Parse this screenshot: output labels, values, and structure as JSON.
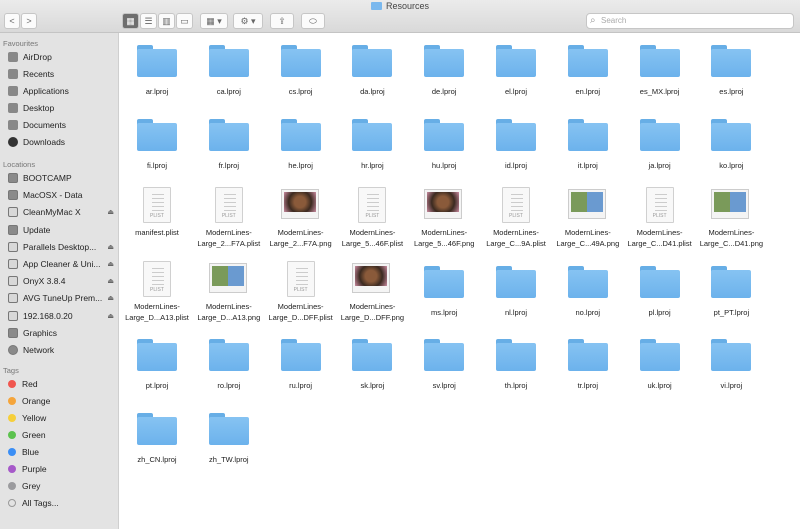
{
  "window": {
    "title": "Resources"
  },
  "toolbar": {
    "back": "<",
    "forward": ">",
    "search_placeholder": "Search"
  },
  "sidebar": {
    "favourites_header": "Favourites",
    "favourites": [
      "AirDrop",
      "Recents",
      "Applications",
      "Desktop",
      "Documents",
      "Downloads"
    ],
    "locations_header": "Locations",
    "locations": [
      {
        "label": "BOOTCAMP",
        "eject": false
      },
      {
        "label": "MacOSX - Data",
        "eject": false
      },
      {
        "label": "CleanMyMac X",
        "eject": true
      },
      {
        "label": "Update",
        "eject": false
      },
      {
        "label": "Parallels Desktop...",
        "eject": true
      },
      {
        "label": "App Cleaner & Uni...",
        "eject": true
      },
      {
        "label": "OnyX 3.8.4",
        "eject": true
      },
      {
        "label": "AVG TuneUp Prem...",
        "eject": true
      },
      {
        "label": "192.168.0.20",
        "eject": true
      },
      {
        "label": "Graphics",
        "eject": false
      },
      {
        "label": "Network",
        "eject": false
      }
    ],
    "tags_header": "Tags",
    "tags": [
      {
        "label": "Red",
        "color": "#f0564f"
      },
      {
        "label": "Orange",
        "color": "#f5a53b"
      },
      {
        "label": "Yellow",
        "color": "#f6cf3a"
      },
      {
        "label": "Green",
        "color": "#5cc24e"
      },
      {
        "label": "Blue",
        "color": "#3a8ef5"
      },
      {
        "label": "Purple",
        "color": "#a659c9"
      },
      {
        "label": "Grey",
        "color": "#9b9b9e"
      },
      {
        "label": "All Tags...",
        "color": ""
      }
    ]
  },
  "files": [
    {
      "name": "ar.lproj",
      "type": "folder"
    },
    {
      "name": "ca.lproj",
      "type": "folder"
    },
    {
      "name": "cs.lproj",
      "type": "folder"
    },
    {
      "name": "da.lproj",
      "type": "folder"
    },
    {
      "name": "de.lproj",
      "type": "folder"
    },
    {
      "name": "el.lproj",
      "type": "folder"
    },
    {
      "name": "en.lproj",
      "type": "folder"
    },
    {
      "name": "es_MX.lproj",
      "type": "folder"
    },
    {
      "name": "es.lproj",
      "type": "folder"
    },
    {
      "name": "fi.lproj",
      "type": "folder"
    },
    {
      "name": "fr.lproj",
      "type": "folder"
    },
    {
      "name": "he.lproj",
      "type": "folder"
    },
    {
      "name": "hr.lproj",
      "type": "folder"
    },
    {
      "name": "hu.lproj",
      "type": "folder"
    },
    {
      "name": "id.lproj",
      "type": "folder"
    },
    {
      "name": "it.lproj",
      "type": "folder"
    },
    {
      "name": "ja.lproj",
      "type": "folder"
    },
    {
      "name": "ko.lproj",
      "type": "folder"
    },
    {
      "name": "manifest.plist",
      "type": "plist"
    },
    {
      "name": "ModernLines-Large_2...F7A.plist",
      "type": "plist"
    },
    {
      "name": "ModernLines-Large_2...F7A.png",
      "type": "png-portrait"
    },
    {
      "name": "ModernLines-Large_5...46F.plist",
      "type": "plist"
    },
    {
      "name": "ModernLines-Large_5...46F.png",
      "type": "png-portrait"
    },
    {
      "name": "ModernLines-Large_C...9A.plist",
      "type": "plist"
    },
    {
      "name": "ModernLines-Large_C...49A.png",
      "type": "png-collage"
    },
    {
      "name": "ModernLines-Large_C...D41.plist",
      "type": "plist"
    },
    {
      "name": "ModernLines-Large_C...D41.png",
      "type": "png-collage"
    },
    {
      "name": "ModernLines-Large_D...A13.plist",
      "type": "plist"
    },
    {
      "name": "ModernLines-Large_D...A13.png",
      "type": "png-collage"
    },
    {
      "name": "ModernLines-Large_D...DFF.plist",
      "type": "plist"
    },
    {
      "name": "ModernLines-Large_D...DFF.png",
      "type": "png-portrait"
    },
    {
      "name": "ms.lproj",
      "type": "folder"
    },
    {
      "name": "nl.lproj",
      "type": "folder"
    },
    {
      "name": "no.lproj",
      "type": "folder"
    },
    {
      "name": "pl.lproj",
      "type": "folder"
    },
    {
      "name": "pt_PT.lproj",
      "type": "folder"
    },
    {
      "name": "pt.lproj",
      "type": "folder"
    },
    {
      "name": "ro.lproj",
      "type": "folder"
    },
    {
      "name": "ru.lproj",
      "type": "folder"
    },
    {
      "name": "sk.lproj",
      "type": "folder"
    },
    {
      "name": "sv.lproj",
      "type": "folder"
    },
    {
      "name": "th.lproj",
      "type": "folder"
    },
    {
      "name": "tr.lproj",
      "type": "folder"
    },
    {
      "name": "uk.lproj",
      "type": "folder"
    },
    {
      "name": "vi.lproj",
      "type": "folder"
    },
    {
      "name": "zh_CN.lproj",
      "type": "folder"
    },
    {
      "name": "zh_TW.lproj",
      "type": "folder"
    }
  ],
  "plist_badge": "PLIST"
}
